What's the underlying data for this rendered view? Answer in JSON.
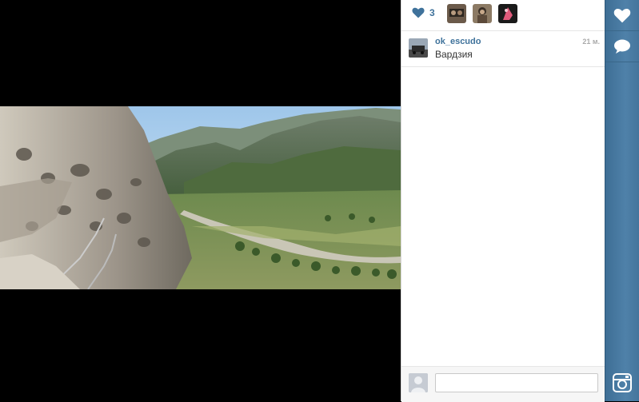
{
  "photo": {
    "alt": ""
  },
  "likes": {
    "count": "3",
    "icon": "heart-icon"
  },
  "comment": {
    "username": "ok_escudo",
    "text": "Вардзия",
    "time": "21 м."
  },
  "comment_box": {
    "value": "",
    "placeholder": ""
  },
  "sidebar": {
    "like_icon": "heart-icon",
    "comment_icon": "speech-bubble-icon",
    "logo_icon": "instagram-camera-icon"
  },
  "colors": {
    "accent": "#3f729b",
    "sidebar": "#4f81a9"
  }
}
